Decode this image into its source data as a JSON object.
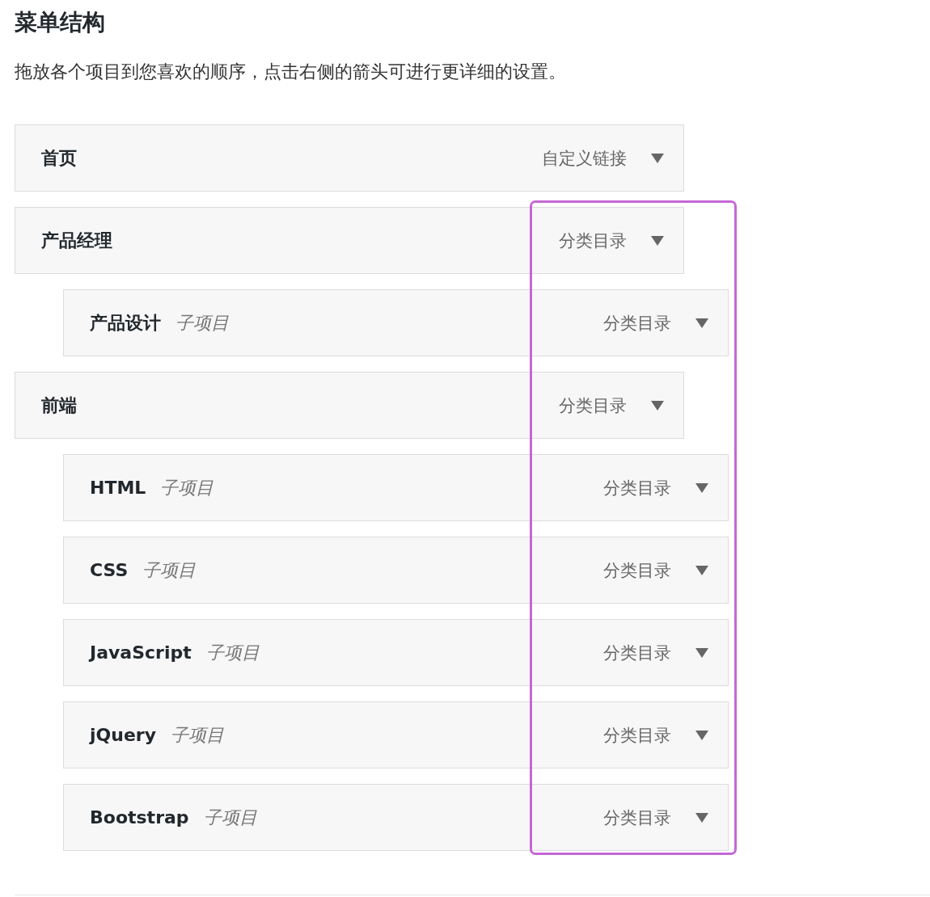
{
  "title": "菜单结构",
  "description": "拖放各个项目到您喜欢的顺序，点击右侧的箭头可进行更详细的设置。",
  "items": [
    {
      "title": "首页",
      "type": "自定义链接"
    },
    {
      "title": "产品经理",
      "type": "分类目录",
      "children": [
        {
          "title": "产品设计",
          "subtitle": "子项目",
          "type": "分类目录"
        }
      ]
    },
    {
      "title": "前端",
      "type": "分类目录",
      "children": [
        {
          "title": "HTML",
          "subtitle": "子项目",
          "type": "分类目录"
        },
        {
          "title": "CSS",
          "subtitle": "子项目",
          "type": "分类目录"
        },
        {
          "title": "JavaScript",
          "subtitle": "子项目",
          "type": "分类目录"
        },
        {
          "title": "jQuery",
          "subtitle": "子项目",
          "type": "分类目录"
        },
        {
          "title": "Bootstrap",
          "subtitle": "子项目",
          "type": "分类目录"
        }
      ]
    }
  ]
}
